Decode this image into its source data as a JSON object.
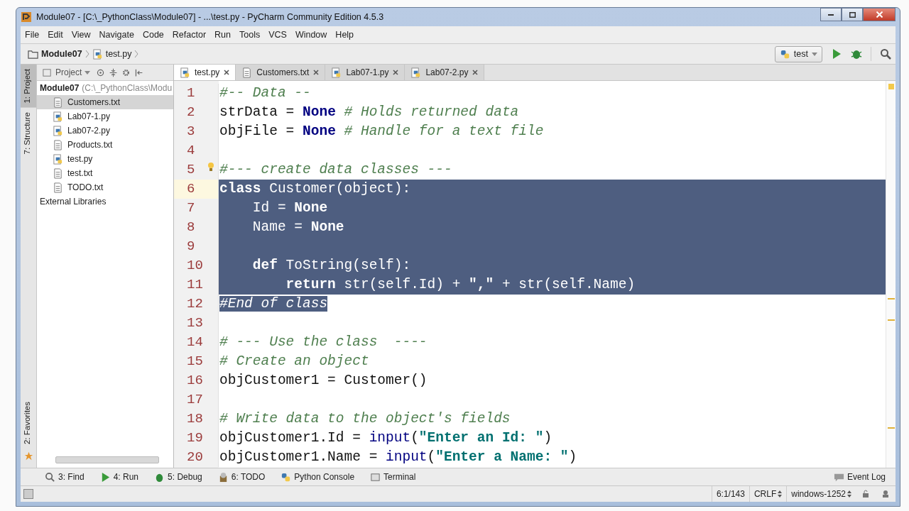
{
  "window": {
    "title": "Module07 - [C:\\_PythonClass\\Module07] - ...\\test.py - PyCharm Community Edition 4.5.3"
  },
  "menu": [
    "File",
    "Edit",
    "View",
    "Navigate",
    "Code",
    "Refactor",
    "Run",
    "Tools",
    "VCS",
    "Window",
    "Help"
  ],
  "breadcrumb": [
    {
      "label": "Module07",
      "kind": "folder"
    },
    {
      "label": "test.py",
      "kind": "py"
    }
  ],
  "run_config": {
    "label": "test"
  },
  "left_stripe": {
    "top": [
      {
        "label": "1: Project",
        "selected": true
      },
      {
        "label": "7: Structure",
        "selected": false
      }
    ],
    "bottom": [
      {
        "label": "2: Favorites",
        "selected": false
      }
    ]
  },
  "project_panel": {
    "title": "Project",
    "root": {
      "name": "Module07",
      "path": "(C:\\_PythonClass\\Modu"
    },
    "items": [
      {
        "label": "Customers.txt",
        "kind": "txt",
        "selected": true
      },
      {
        "label": "Lab07-1.py",
        "kind": "py",
        "selected": false
      },
      {
        "label": "Lab07-2.py",
        "kind": "py",
        "selected": false
      },
      {
        "label": "Products.txt",
        "kind": "txt",
        "selected": false
      },
      {
        "label": "test.py",
        "kind": "py",
        "selected": false
      },
      {
        "label": "test.txt",
        "kind": "txt",
        "selected": false
      },
      {
        "label": "TODO.txt",
        "kind": "txt",
        "selected": false
      }
    ],
    "external": "External Libraries"
  },
  "tabs": [
    {
      "label": "test.py",
      "kind": "py",
      "selected": true
    },
    {
      "label": "Customers.txt",
      "kind": "txt",
      "selected": false
    },
    {
      "label": "Lab07-1.py",
      "kind": "py",
      "selected": false
    },
    {
      "label": "Lab07-2.py",
      "kind": "py",
      "selected": false
    }
  ],
  "editor": {
    "lines": [
      {
        "number": "1",
        "selected": false,
        "current": false,
        "tokens": [
          {
            "kind": "comment",
            "text": "#-- Data --"
          }
        ]
      },
      {
        "number": "2",
        "selected": false,
        "current": false,
        "tokens": [
          {
            "kind": "text",
            "text": "strData = "
          },
          {
            "kind": "keyword",
            "text": "None"
          },
          {
            "kind": "comment",
            "text": " # Holds returned data"
          }
        ]
      },
      {
        "number": "3",
        "selected": false,
        "current": false,
        "tokens": [
          {
            "kind": "text",
            "text": "objFile = "
          },
          {
            "kind": "keyword",
            "text": "None"
          },
          {
            "kind": "comment",
            "text": " # Handle for a text file"
          }
        ]
      },
      {
        "number": "4",
        "selected": false,
        "current": false
      },
      {
        "number": "5",
        "selected": false,
        "current": false,
        "tokens": [
          {
            "kind": "comment",
            "text": "#--- create data classes ---"
          }
        ]
      },
      {
        "number": "6",
        "selected": true,
        "current": true,
        "tokens": [
          {
            "kind": "keyword",
            "text": "class"
          },
          {
            "kind": "text",
            "text": " Customer(object):"
          }
        ]
      },
      {
        "number": "7",
        "selected": true,
        "current": false,
        "tokens": [
          {
            "kind": "text",
            "text": "    Id = "
          },
          {
            "kind": "keyword",
            "text": "None"
          }
        ]
      },
      {
        "number": "8",
        "selected": true,
        "current": false,
        "tokens": [
          {
            "kind": "text",
            "text": "    Name = "
          },
          {
            "kind": "keyword",
            "text": "None"
          }
        ]
      },
      {
        "number": "9",
        "selected": true,
        "current": false
      },
      {
        "number": "10",
        "selected": true,
        "current": false,
        "tokens": [
          {
            "kind": "keyword",
            "text": "    def"
          },
          {
            "kind": "text",
            "text": " ToString(self):"
          }
        ]
      },
      {
        "number": "11",
        "selected": true,
        "current": false,
        "tokens": [
          {
            "kind": "keyword",
            "text": "        return "
          },
          {
            "kind": "builtin",
            "text": "str"
          },
          {
            "kind": "text",
            "text": "(self.Id) + "
          },
          {
            "kind": "string",
            "text": "\",\""
          },
          {
            "kind": "text",
            "text": " + "
          },
          {
            "kind": "builtin",
            "text": "str"
          },
          {
            "kind": "text",
            "text": "(self.Name)"
          }
        ]
      },
      {
        "number": "12",
        "selected": true,
        "current": false,
        "tokens": [
          {
            "kind": "comment",
            "text": "#End of class"
          }
        ]
      },
      {
        "number": "13",
        "selected": false,
        "current": false
      },
      {
        "number": "14",
        "selected": false,
        "current": false,
        "tokens": [
          {
            "kind": "comment",
            "text": "# --- Use the class  ----"
          }
        ]
      },
      {
        "number": "15",
        "selected": false,
        "current": false,
        "tokens": [
          {
            "kind": "comment",
            "text": "# Create an object"
          }
        ]
      },
      {
        "number": "16",
        "selected": false,
        "current": false,
        "tokens": [
          {
            "kind": "text",
            "text": "objCustomer1 = Customer()"
          }
        ]
      },
      {
        "number": "17",
        "selected": false,
        "current": false
      },
      {
        "number": "18",
        "selected": false,
        "current": false,
        "tokens": [
          {
            "kind": "comment",
            "text": "# Write data to the object's fields"
          }
        ]
      },
      {
        "number": "19",
        "selected": false,
        "current": false,
        "tokens": [
          {
            "kind": "text",
            "text": "objCustomer1.Id = "
          },
          {
            "kind": "builtin",
            "text": "input"
          },
          {
            "kind": "text",
            "text": "("
          },
          {
            "kind": "string",
            "text": "\"Enter an Id: \""
          },
          {
            "kind": "text",
            "text": ")"
          }
        ]
      },
      {
        "number": "20",
        "selected": false,
        "current": false,
        "tokens": [
          {
            "kind": "text",
            "text": "objCustomer1.Name = "
          },
          {
            "kind": "builtin",
            "text": "input"
          },
          {
            "kind": "text",
            "text": "("
          },
          {
            "kind": "string",
            "text": "\"Enter a Name: \""
          },
          {
            "kind": "text",
            "text": ")"
          }
        ]
      }
    ]
  },
  "tool_buttons": [
    {
      "label": "3: Find",
      "kind": "find"
    },
    {
      "label": "4: Run",
      "kind": "run"
    },
    {
      "label": "5: Debug",
      "kind": "debug"
    },
    {
      "label": "6: TODO",
      "kind": "todo"
    },
    {
      "label": "Python Console",
      "kind": "console"
    },
    {
      "label": "Terminal",
      "kind": "terminal"
    }
  ],
  "event_log": "Event Log",
  "status_bar": {
    "position": "6:1/143",
    "line_separator": "CRLF",
    "encoding": "windows-1252"
  }
}
